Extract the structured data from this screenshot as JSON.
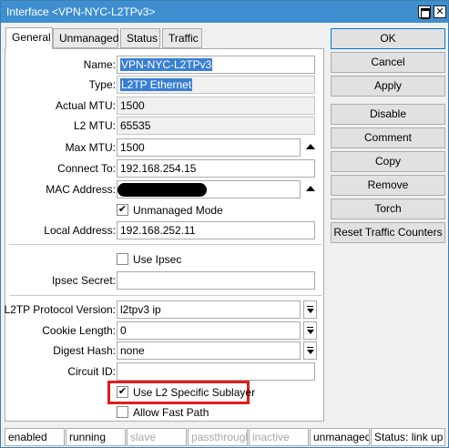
{
  "window": {
    "title": "Interface <VPN-NYC-L2TPv3>",
    "max_button": "□",
    "close_button": "✕"
  },
  "tabs": [
    {
      "label": "General",
      "active": true
    },
    {
      "label": "Unmanaged",
      "active": false
    },
    {
      "label": "Status",
      "active": false
    },
    {
      "label": "Traffic",
      "active": false
    }
  ],
  "form": {
    "name": {
      "label": "Name:",
      "value": "VPN-NYC-L2TPv3"
    },
    "type": {
      "label": "Type:",
      "value": "L2TP Ethernet"
    },
    "actual_mtu": {
      "label": "Actual MTU:",
      "value": "1500"
    },
    "l2_mtu": {
      "label": "L2 MTU:",
      "value": "65535"
    },
    "max_mtu": {
      "label": "Max MTU:",
      "value": "1500"
    },
    "connect_to": {
      "label": "Connect To:",
      "value": "192.168.254.15"
    },
    "mac_address": {
      "label": "MAC Address:",
      "value": ""
    },
    "unmanaged_mode": {
      "label": "Unmanaged Mode",
      "checked": true
    },
    "local_address": {
      "label": "Local Address:",
      "value": "192.168.252.11"
    },
    "use_ipsec": {
      "label": "Use Ipsec",
      "checked": false
    },
    "ipsec_secret": {
      "label": "Ipsec Secret:",
      "value": ""
    },
    "l2tp_protocol_version": {
      "label": "L2TP Protocol Version:",
      "value": "l2tpv3 ip"
    },
    "cookie_length": {
      "label": "Cookie Length:",
      "value": "0"
    },
    "digest_hash": {
      "label": "Digest Hash:",
      "value": "none"
    },
    "circuit_id": {
      "label": "Circuit ID:",
      "value": ""
    },
    "use_l2_specific_sublayer": {
      "label": "Use L2 Specific Sublayer",
      "checked": true
    },
    "allow_fast_path": {
      "label": "Allow Fast Path",
      "checked": false
    }
  },
  "buttons": {
    "ok": "OK",
    "cancel": "Cancel",
    "apply": "Apply",
    "disable": "Disable",
    "comment": "Comment",
    "copy": "Copy",
    "remove": "Remove",
    "torch": "Torch",
    "reset_traffic_counters": "Reset Traffic Counters"
  },
  "status_bar": {
    "enabled": "enabled",
    "running": "running",
    "slave": "slave",
    "passthrough": "passthrough",
    "inactive": "inactive",
    "unmanaged": "unmanaged",
    "status": "Status: link up"
  },
  "check_mark": "✔",
  "colors": {
    "titlebar": "#3f8fd0",
    "highlight_box": "#e21c1c",
    "selection": "#3a7fd3"
  }
}
